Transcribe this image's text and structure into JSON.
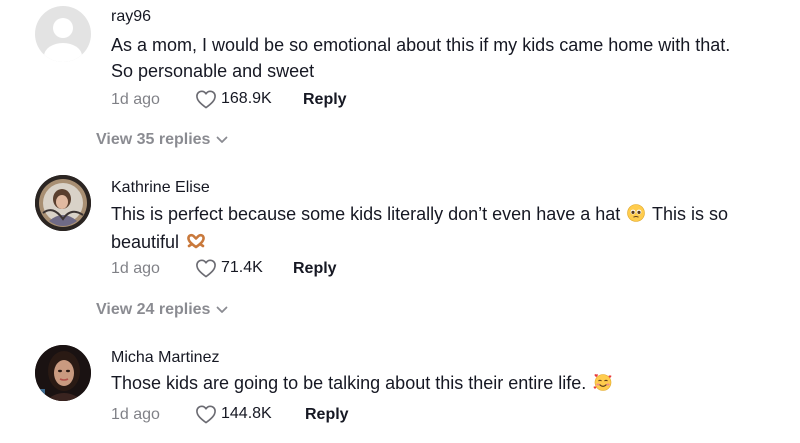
{
  "comments": [
    {
      "username": "ray96",
      "text": "As a mom, I would be so emotional about this if my kids came home with that. So personable and sweet",
      "time": "1d ago",
      "likes": "168.9K",
      "reply_label": "Reply",
      "avatar_icon": "default-avatar-icon",
      "view_replies": "View 35 replies"
    },
    {
      "username": "Kathrine Elise",
      "text_before": "This is perfect because some kids literally don’t even have a hat",
      "text_middle": "This is so beautiful",
      "emoji_1": "pleading-face-emoji",
      "emoji_2": "heart-hands-emoji",
      "time": "1d ago",
      "likes": "71.4K",
      "reply_label": "Reply",
      "view_replies": "View 24 replies"
    },
    {
      "username": "Micha Martinez",
      "text": "Those kids are going to be talking about this their entire life.",
      "emoji": "smiling-face-with-hearts-emoji",
      "time": "1d ago",
      "likes": "144.8K",
      "reply_label": "Reply"
    }
  ]
}
